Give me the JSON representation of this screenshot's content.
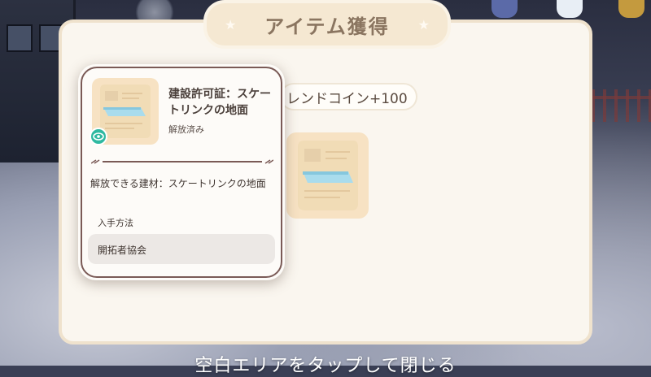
{
  "dialog": {
    "title": "アイテム獲得",
    "reward_text": "レンドコイン+100",
    "close_hint": "空白エリアをタップして閉じる"
  },
  "item_card": {
    "name": "建設許可証：スケートリンクの地面",
    "status": "解放済み",
    "description": "解放できる建材：スケートリンクの地面",
    "obtain_label": "入手方法",
    "source": "開拓者協会",
    "icon": "blueprint-scroll-icon"
  },
  "colors": {
    "dialog_bg": "#faf6ef",
    "title_tab": "#f5e8d2",
    "item_bg": "#f7e2c3",
    "card_border": "#7a5a56",
    "badge": "#2fb9a1"
  }
}
